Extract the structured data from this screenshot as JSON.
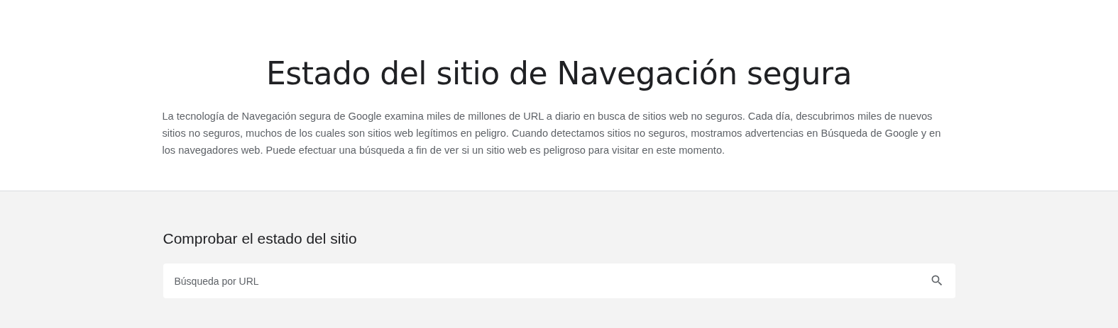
{
  "header": {
    "title": "Estado del sitio de Navegación segura",
    "description": "La tecnología de Navegación segura de Google examina miles de millones de URL a diario en busca de sitios web no seguros. Cada día, descubrimos miles de nuevos sitios no seguros, muchos de los cuales son sitios web legítimos en peligro. Cuando detectamos sitios no seguros, mostramos advertencias en Búsqueda de Google y en los navegadores web. Puede efectuar una búsqueda a fin de ver si un sitio web es peligroso para visitar en este momento."
  },
  "check": {
    "heading": "Comprobar el estado del sitio",
    "search": {
      "placeholder": "Búsqueda por URL"
    }
  }
}
